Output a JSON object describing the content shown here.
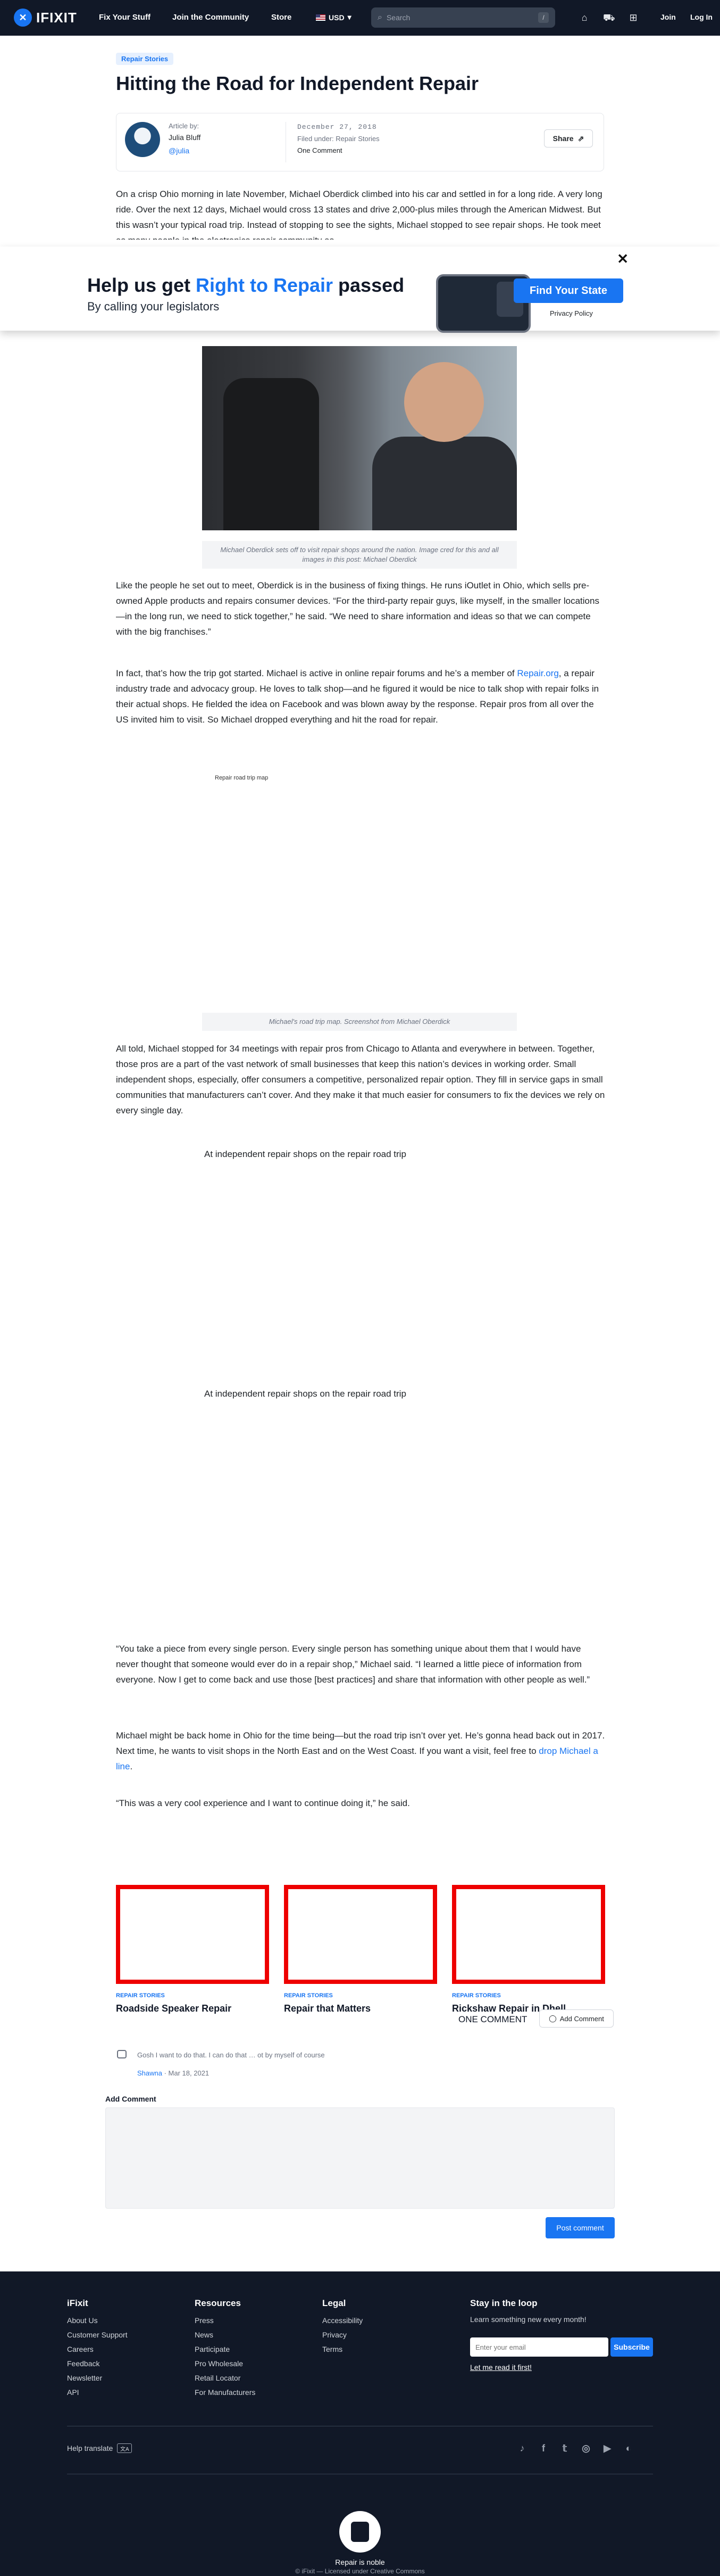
{
  "nav": {
    "logo": "IFIXIT",
    "links": [
      "Fix Your Stuff",
      "Join the Community",
      "Store"
    ],
    "lang": "USD",
    "search_placeholder": "Search",
    "search_kbd": "/",
    "join": "Join",
    "login": "Log In"
  },
  "article": {
    "tag": "Repair Stories",
    "title": "Hitting the Road for Independent Repair",
    "author_label": "Article by:",
    "author_name": "Julia Bluff",
    "author_handle": "@julia",
    "date": "December 27, 2018",
    "filed_label": "Filed under:",
    "filed_value": "Repair Stories",
    "comment_count": "One Comment",
    "share": "Share",
    "p1": "On a crisp Ohio morning in late November, Michael Oberdick climbed into his car and settled in for a long ride. A very long ride. Over the next 12 days, Michael would cross 13 states and drive 2,000-plus miles through the American Midwest. But this wasn’t your typical road trip. Instead of stopping to see the sights, Michael stopped to see repair shops. He took meet as many people in the electronics repair community as",
    "caption1": "Michael Oberdick sets off to visit repair shops around the nation. Image cred for this and all images in this post: Michael Oberdick",
    "p2": "Like the people he set out to meet, Oberdick is in the business of fixing things. He runs iOutlet in Ohio, which sells pre-owned Apple products and repairs consumer devices. “For the third-party repair guys, like myself, in the smaller locations—in the long run, we need to stick together,” he said. “We need to share information and ideas so that we can compete with the big franchises.”",
    "p3_a": "In fact, that’s how the trip got started. Michael is active in online repair forums and he’s a member of ",
    "p3_link": "Repair.org",
    "p3_b": ", a repair industry trade and advocacy group. He loves to talk shop—and he figured it would be nice to talk shop with repair folks in their actual shops. He fielded the idea on Facebook and was blown away by the response. Repair pros from all over the US invited him to visit. So Michael dropped everything and hit the road for repair.",
    "map_alt": "Repair road trip map",
    "caption2": "Michael's road trip map. Screenshot from Michael Oberdick",
    "p4": "All told, Michael stopped for 34 meetings with repair pros from Chicago to Atlanta and everywhere in between. Together, those pros are a part of the vast network of small businesses that keep this nation’s devices in working order. Small independent shops, especially, offer consumers a competitive, personalized repair option. They fill in service gaps in small communities that manufacturers can’t cover. And they make it that much easier for consumers to fix the devices we rely on every single day.",
    "embed1": "At independent repair shops on the repair road trip",
    "embed2": "At independent repair shops on the repair road trip",
    "p5": "“You take a piece from every single person. Every single person has something unique about them that I would have never thought that someone would ever do in a repair shop,” Michael said. “I learned a little piece of information from everyone. Now I get to come back and use those [best practices] and share that information with other people as well.”",
    "p6_a": "Michael might be back home in Ohio for the time being—but the road trip isn’t over yet. He’s gonna head back out in 2017. Next time, he wants to visit shops in the North East and on the West Coast. If you want a visit, feel free to ",
    "p6_link": "drop Michael a line",
    "p6_b": ".",
    "p7": "“This was a very cool experience and I want to continue doing it,” he said."
  },
  "banner": {
    "close": "✕",
    "head_a": "Help us get ",
    "head_hl": "Right to Repair",
    "head_b": " passed",
    "sub": "By calling your legislators",
    "cta": "Find Your State",
    "privacy": "Privacy Policy"
  },
  "related": [
    {
      "tag": "REPAIR STORIES",
      "title": "Roadside Speaker Repair"
    },
    {
      "tag": "REPAIR STORIES",
      "title": "Repair that Matters"
    },
    {
      "tag": "REPAIR STORIES",
      "title": "Rickshaw Repair in Dhell"
    }
  ],
  "comments": {
    "title": "ONE COMMENT",
    "add_button": "Add Comment",
    "items": [
      {
        "text": "Gosh I want to do that. I can do that … ot by myself of course",
        "author": "Shawna",
        "date": "Mar 18, 2021"
      }
    ],
    "add_label": "Add Comment",
    "post": "Post comment"
  },
  "footer": {
    "col1": {
      "title": "iFixit",
      "links": [
        "About Us",
        "Customer Support",
        "Careers",
        "Feedback",
        "Newsletter",
        "API"
      ]
    },
    "col2": {
      "title": "Resources",
      "links": [
        "Press",
        "News",
        "Participate",
        "Pro Wholesale",
        "Retail Locator",
        "For Manufacturers"
      ]
    },
    "col3": {
      "title": "Legal",
      "links": [
        "Accessibility",
        "Privacy",
        "Terms"
      ]
    },
    "stay_title": "Stay in the loop",
    "stay_sub": "Learn something new every month!",
    "email_placeholder": "Enter your email",
    "subscribe": "Subscribe",
    "read_it": "Let me read it first!",
    "help_translate": "Help translate",
    "socials": [
      "tiktok-icon",
      "facebook-icon",
      "twitter-icon",
      "instagram-icon",
      "youtube-icon",
      "discourse-icon"
    ],
    "noble": "Repair is noble",
    "license": "© iFixit — Licensed under Creative Commons"
  },
  "colors": {
    "accent": "#1975f2",
    "nav_bg": "#111827",
    "related_border": "#ee0000"
  }
}
